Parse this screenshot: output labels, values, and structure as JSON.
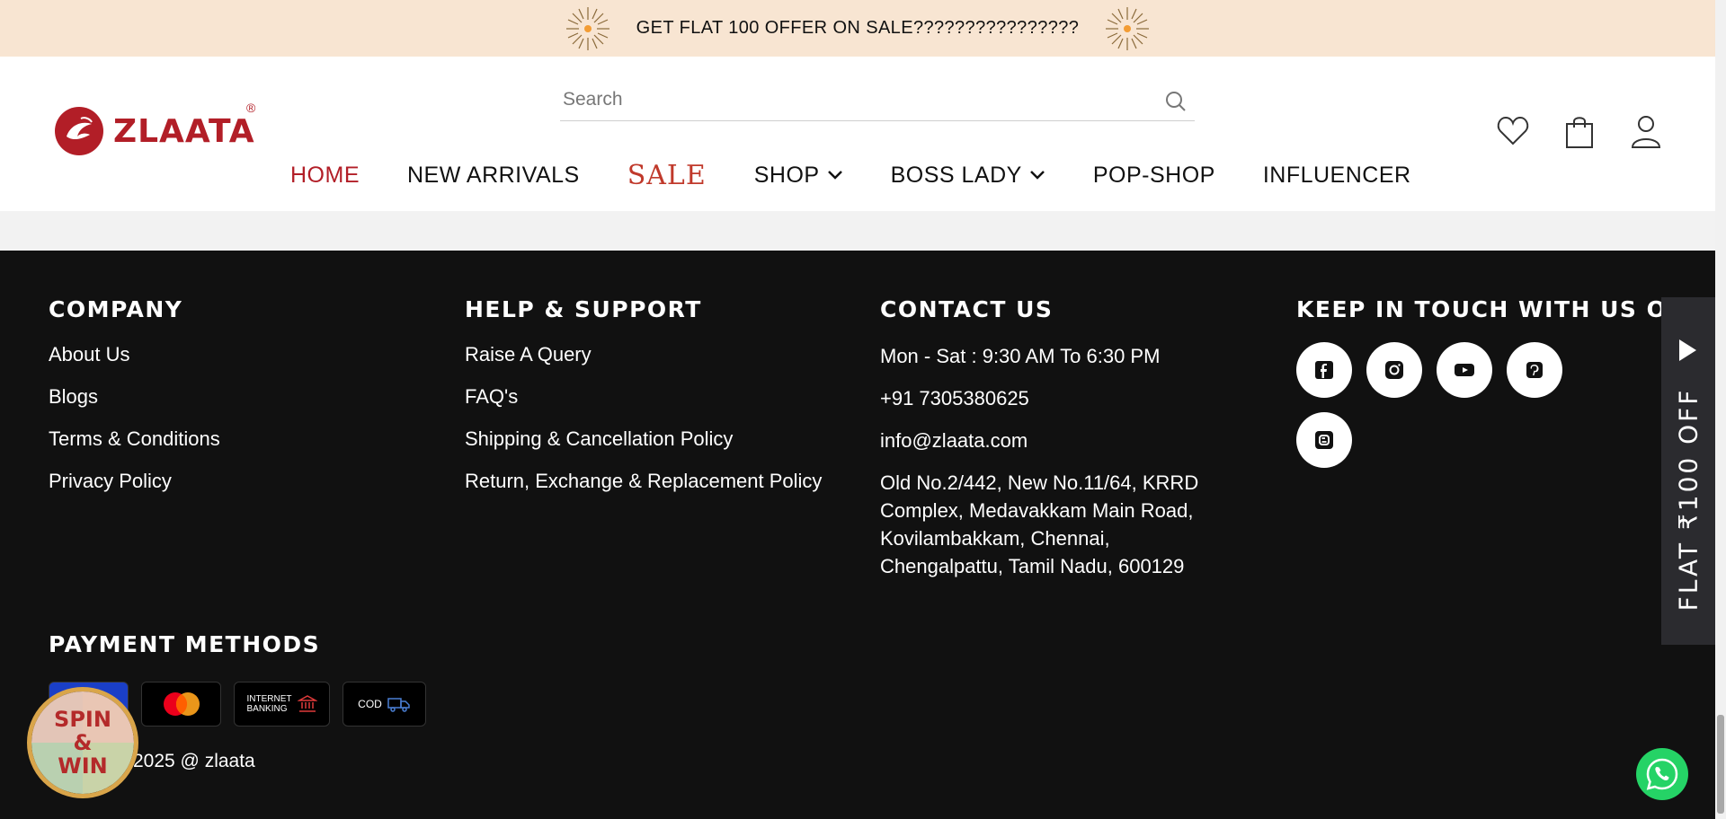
{
  "announcement": {
    "text": "GET FLAT 100 OFFER ON SALE????????????????"
  },
  "header": {
    "logo_text": "ZLAATA",
    "logo_reg": "®",
    "search_placeholder": "Search",
    "nav": {
      "home": "HOME",
      "new_arrivals": "NEW ARRIVALS",
      "sale": "SALE",
      "shop": "SHOP",
      "boss_lady": "BOSS LADY",
      "pop_shop": "POP-SHOP",
      "influencer": "INFLUENCER"
    }
  },
  "footer": {
    "company": {
      "heading": "COMPANY",
      "links": [
        "About Us",
        "Blogs",
        "Terms & Conditions",
        "Privacy Policy"
      ]
    },
    "help": {
      "heading": "HELP & SUPPORT",
      "links": [
        "Raise A Query",
        "FAQ's",
        "Shipping & Cancellation Policy",
        "Return, Exchange & Replacement Policy"
      ]
    },
    "contact": {
      "heading": "CONTACT US",
      "hours": "Mon - Sat : 9:30 AM To 6:30 PM",
      "phone": "+91 7305380625",
      "email": "info@zlaata.com",
      "address": "Old No.2/442, New No.11/64, KRRD Complex, Medavakkam Main Road, Kovilambakkam, Chennai, Chengalpattu, Tamil Nadu, 600129"
    },
    "social": {
      "heading": "KEEP IN TOUCH WITH US ON",
      "icons": [
        "facebook-icon",
        "instagram-icon",
        "youtube-icon",
        "pinterest-icon",
        "blogger-icon"
      ]
    },
    "payment": {
      "heading": "PAYMENT METHODS",
      "netbanking_label_1": "INTERNET",
      "netbanking_label_2": "BANKING",
      "cod_label": "COD"
    },
    "copyright": "2025 @ zlaata"
  },
  "spin_win": {
    "line1": "SPIN",
    "line2": "&",
    "line3": "WIN"
  },
  "side_tab": {
    "text": "FLAT ₹100 OFF"
  },
  "colors": {
    "brand_red": "#b21e27",
    "announcement_bg": "#f8e5d2",
    "footer_bg": "#111111",
    "whatsapp_green": "#25d366"
  }
}
